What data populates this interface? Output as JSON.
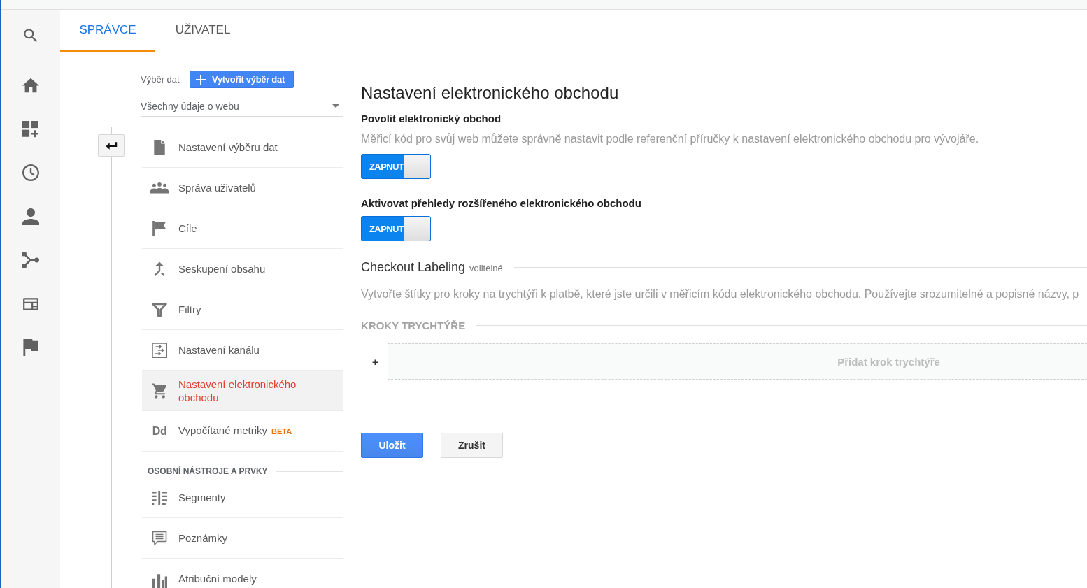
{
  "tabs": [
    {
      "label": "SPRÁVCE",
      "selected": true
    },
    {
      "label": "UŽIVATEL",
      "selected": false
    }
  ],
  "data_selection": {
    "label": "Výběr dat",
    "create_button": "Vytvořit výběr dat",
    "dropdown": {
      "value": "Všechny údaje o webu"
    }
  },
  "nav": {
    "sections": [
      {
        "items": [
          {
            "label": "Nastavení výběru dat",
            "selected": false
          },
          {
            "label": "Správa uživatelů",
            "selected": false
          },
          {
            "label": "Cíle",
            "selected": false
          },
          {
            "label": "Seskupení obsahu",
            "selected": false
          },
          {
            "label": "Filtry",
            "selected": false
          },
          {
            "label": "Nastavení kanálu",
            "selected": false
          },
          {
            "label": "Nastavení elektronického obchodu",
            "selected": true
          },
          {
            "label": "Vypočítané metriky",
            "glyph": "Dd",
            "badge": "BETA",
            "selected": false
          }
        ]
      },
      {
        "heading": "OSOBNÍ NÁSTROJE A PRVKY",
        "items": [
          {
            "label": "Segmenty",
            "selected": false
          },
          {
            "label": "Poznámky",
            "selected": false
          },
          {
            "label": "Atribuční modely",
            "selected": false
          }
        ]
      }
    ]
  },
  "content": {
    "title": "Nastavení elektronického obchodu",
    "settings": [
      {
        "label": "Povolit elektronický obchod",
        "description": "Měřicí kód pro svůj web můžete správně nastavit podle referenční příručky k nastavení elektronického obchodu pro vývojáře.",
        "switch": {
          "label": "ZAPNUT",
          "on": true
        }
      },
      {
        "label": "Aktivovat přehledy rozšířeného elektronického obchodu",
        "switch": {
          "label": "ZAPNUT",
          "on": true
        }
      }
    ],
    "checkout": {
      "title": "Checkout Labeling",
      "optional": "volitelné",
      "description": "Vytvořte štítky pro kroky na trychtýři k platbě, které jste určili v měřicím kódu elektronického obchodu. Používejte srozumitelné a popisné názvy, p",
      "steps_heading": "KROKY TRYCHTÝŘE",
      "add_symbol": "+",
      "add_step": "Přidat krok trychtýře"
    },
    "buttons": [
      {
        "label": "Uložit",
        "kind": "primary"
      },
      {
        "label": "Zrušit",
        "kind": "secondary"
      }
    ]
  }
}
